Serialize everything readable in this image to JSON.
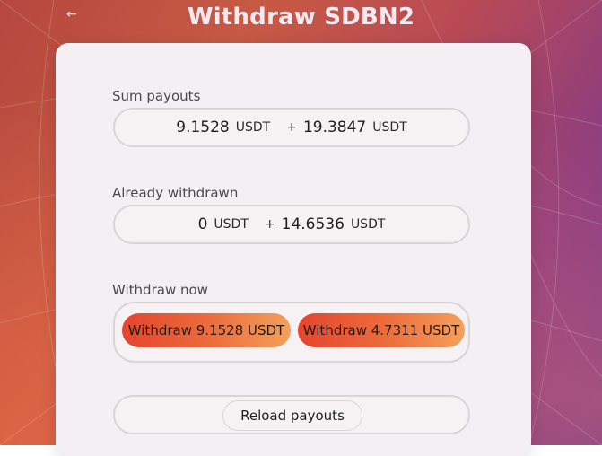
{
  "header": {
    "back_icon": "arrow-left-icon",
    "back_glyph": "←",
    "title": "Withdraw SDBN2"
  },
  "sum_payouts": {
    "label": "Sum payouts",
    "value_a": "9.1528",
    "unit_a": "USDT",
    "plus": "+",
    "value_b": "19.3847",
    "unit_b": "USDT"
  },
  "already_withdrawn": {
    "label": "Already withdrawn",
    "value_a": "0",
    "unit_a": "USDT",
    "plus": "+",
    "value_b": "14.6536",
    "unit_b": "USDT"
  },
  "withdraw_now": {
    "label": "Withdraw now",
    "button_a": "Withdraw 9.1528 USDT",
    "button_b": "Withdraw 4.7311 USDT"
  },
  "reload": {
    "label": "Reload payouts"
  },
  "colors": {
    "accent_gradient_start": "#e4452e",
    "accent_gradient_end": "#f3a05a",
    "card_background": "#f4eff2"
  }
}
